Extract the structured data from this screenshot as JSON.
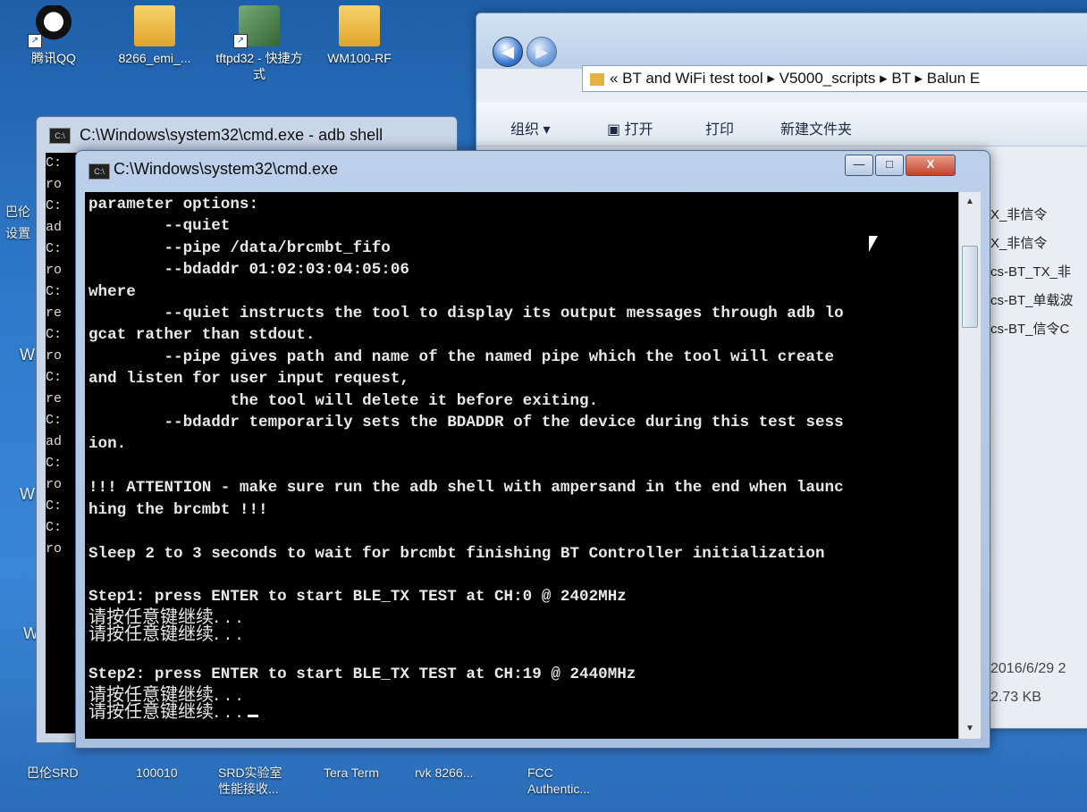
{
  "desktop": {
    "icons": [
      {
        "label": "腾讯QQ",
        "icon": "qq-icon"
      },
      {
        "label": "8266_emi_...",
        "icon": "folder-icon"
      },
      {
        "label": "tftpd32 - 快捷方式",
        "icon": "tftp-icon"
      },
      {
        "label": "WM100-RF",
        "icon": "folder-icon"
      }
    ],
    "left_fragments": [
      "巴伦",
      "设置",
      "W",
      "W",
      "W"
    ],
    "bottom_labels": [
      "巴伦SRD",
      "100010",
      "SRD实验室\n性能接收...",
      "Tera Term",
      "rvk 8266...",
      "FCC\nAuthentic..."
    ]
  },
  "explorer": {
    "breadcrumb": "« BT and WiFi test tool ▸ V5000_scripts ▸ BT ▸ Balun E",
    "toolbar": {
      "organize": "组织 ▾",
      "open": "打开",
      "print": "打印",
      "new_folder": "新建文件夹"
    },
    "files": [
      "X_非信令",
      "X_非信令",
      "cs-BT_TX_非",
      "cs-BT_单载波",
      "cs-BT_信令C"
    ],
    "detail_date": "2016/6/29 2",
    "detail_size": "2.73 KB"
  },
  "cmd_back": {
    "title": "C:\\Windows\\system32\\cmd.exe - adb  shell",
    "lines": [
      "C:",
      "ro",
      "C:",
      "ad",
      "",
      "C:",
      "ro",
      "C:",
      "re",
      "",
      "C:",
      "ro",
      "C:",
      "re",
      "",
      "C:",
      "ad",
      "",
      "C:",
      "ro",
      "C:",
      "",
      "C:",
      "ro"
    ]
  },
  "cmd": {
    "title": "C:\\Windows\\system32\\cmd.exe",
    "buttons": {
      "minimize": "—",
      "maximize": "□",
      "close": "X"
    },
    "lines": [
      "parameter options:",
      "        --quiet",
      "        --pipe /data/brcmbt_fifo",
      "        --bdaddr 01:02:03:04:05:06",
      "where",
      "        --quiet instructs the tool to display its output messages through adb lo",
      "gcat rather than stdout.",
      "        --pipe gives path and name of the named pipe which the tool will create",
      "and listen for user input request,",
      "               the tool will delete it before exiting.",
      "        --bdaddr temporarily sets the BDADDR of the device during this test sess",
      "ion.",
      "",
      "!!! ATTENTION - make sure run the adb shell with ampersand in the end when launc",
      "hing the brcmbt !!!",
      "",
      "Sleep 2 to 3 seconds to wait for brcmbt finishing BT Controller initialization",
      "",
      "Step1: press ENTER to start BLE_TX TEST at CH:0 @ 2402MHz"
    ],
    "pause1": "请按任意键继续. . .",
    "pause2": "请按任意键继续. . .",
    "step2": "Step2: press ENTER to start BLE_TX TEST at CH:19 @ 2440MHz",
    "pause3": "请按任意键继续. . .",
    "pause4": "请按任意键继续. . ."
  }
}
